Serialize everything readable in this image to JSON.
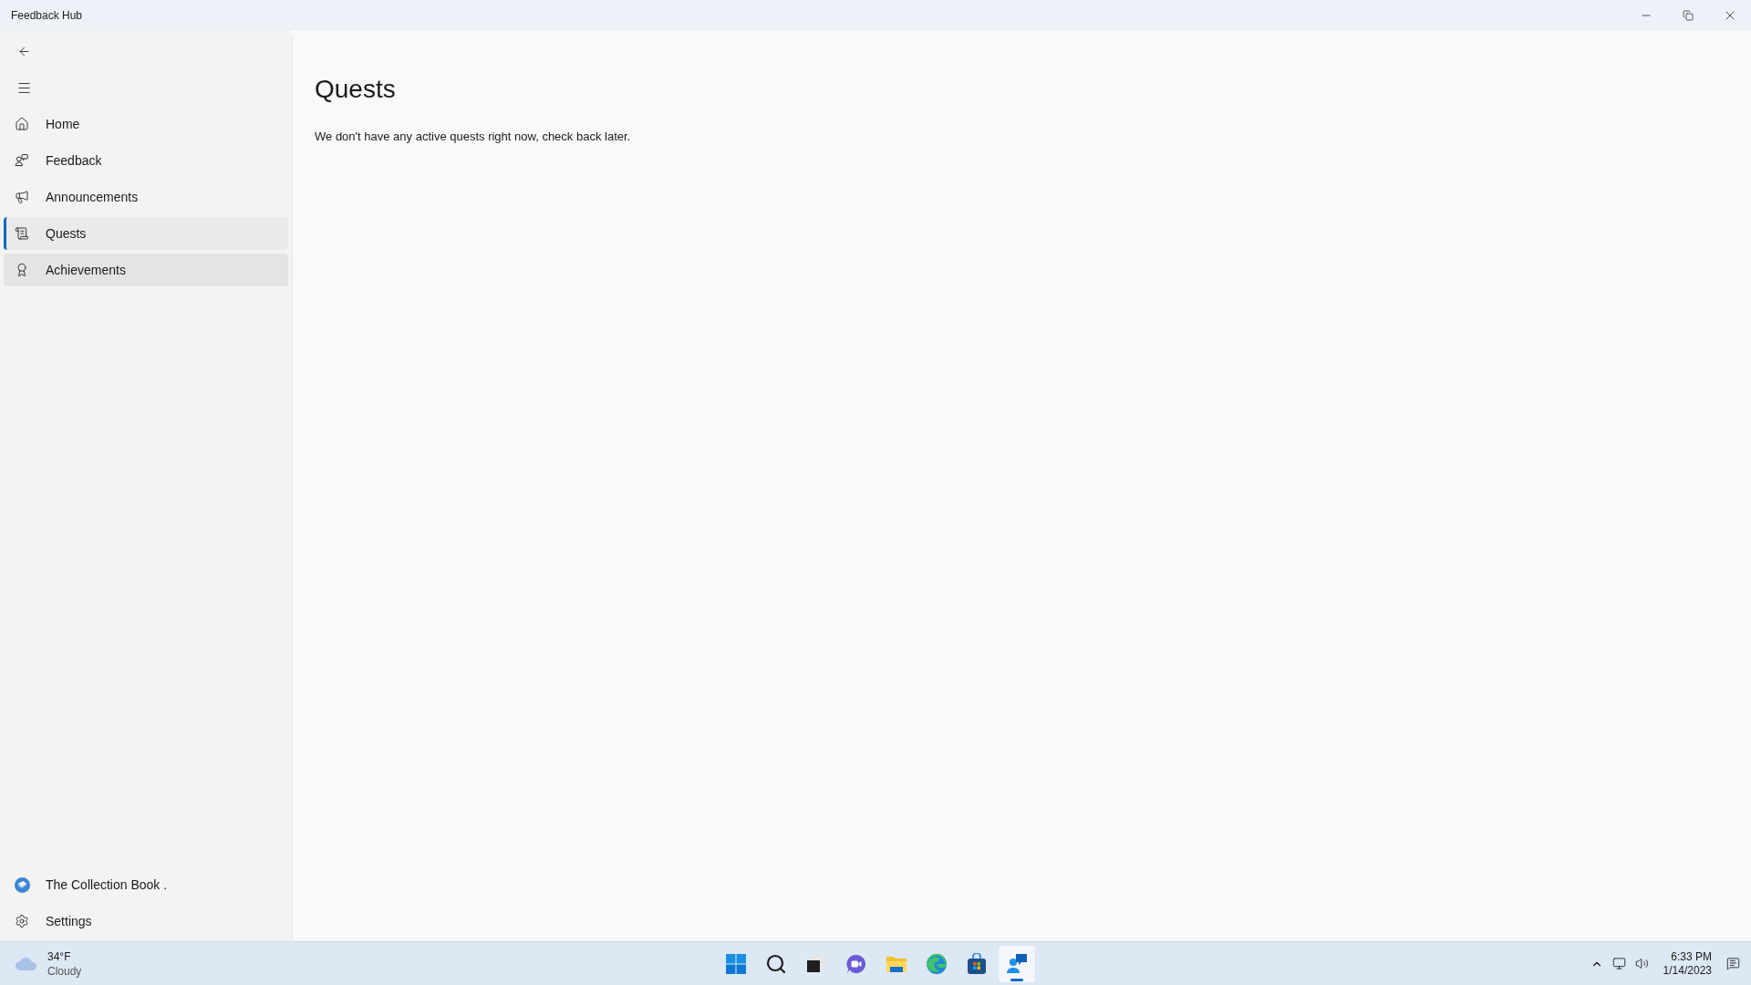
{
  "window": {
    "title": "Feedback Hub"
  },
  "sidebar": {
    "items": [
      {
        "label": "Home",
        "selected": false,
        "hovered": false
      },
      {
        "label": "Feedback",
        "selected": false,
        "hovered": false
      },
      {
        "label": "Announcements",
        "selected": false,
        "hovered": false
      },
      {
        "label": "Quests",
        "selected": true,
        "hovered": false
      },
      {
        "label": "Achievements",
        "selected": false,
        "hovered": true
      }
    ],
    "account": "The Collection Book .",
    "settings": "Settings"
  },
  "content": {
    "title": "Quests",
    "message": "We don't have any active quests right now, check back later."
  },
  "taskbar": {
    "weather": {
      "temperature": "34°F",
      "condition": "Cloudy"
    },
    "apps": [
      {
        "active": false
      },
      {
        "active": false
      },
      {
        "active": false
      },
      {
        "active": false
      },
      {
        "active": false
      },
      {
        "active": false
      },
      {
        "active": false
      },
      {
        "active": true
      }
    ],
    "time": "6:33 PM",
    "date": "1/14/2023"
  }
}
